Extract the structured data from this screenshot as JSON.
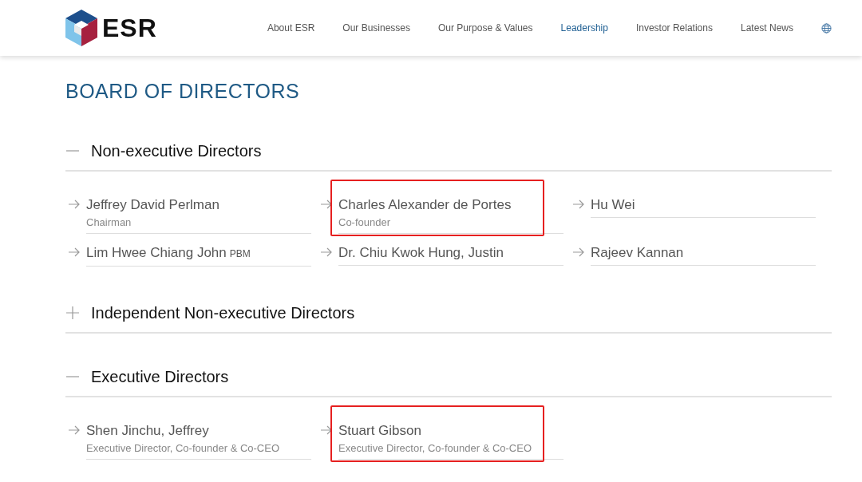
{
  "header": {
    "logo": "ESR",
    "nav": [
      {
        "label": "About ESR",
        "selected": false
      },
      {
        "label": "Our Businesses",
        "selected": false
      },
      {
        "label": "Our Purpose & Values",
        "selected": false
      },
      {
        "label": "Leadership",
        "selected": true
      },
      {
        "label": "Investor Relations",
        "selected": false
      },
      {
        "label": "Latest News",
        "selected": false
      }
    ]
  },
  "page_title": "BOARD OF DIRECTORS",
  "sections": [
    {
      "title": "Non-executive Directors",
      "expanded": true,
      "directors": [
        {
          "name": "Jeffrey David Perlman",
          "role": "Chairman",
          "highlighted": false
        },
        {
          "name": "Charles Alexander de Portes",
          "role": "Co-founder",
          "highlighted": true
        },
        {
          "name": "Hu Wei",
          "highlighted": false
        },
        {
          "name": "Lim Hwee Chiang John",
          "suffix": "PBM",
          "highlighted": false
        },
        {
          "name": "Dr. Chiu Kwok Hung, Justin",
          "highlighted": false
        },
        {
          "name": "Rajeev Kannan",
          "highlighted": false
        }
      ]
    },
    {
      "title": "Independent Non-executive Directors",
      "expanded": false
    },
    {
      "title": "Executive Directors",
      "expanded": true,
      "directors": [
        {
          "name": "Shen Jinchu, Jeffrey",
          "role": "Executive Director, Co-founder & Co-CEO",
          "highlighted": false
        },
        {
          "name": "Stuart Gibson",
          "role": "Executive Director, Co-founder & Co-CEO",
          "highlighted": true
        }
      ]
    }
  ]
}
